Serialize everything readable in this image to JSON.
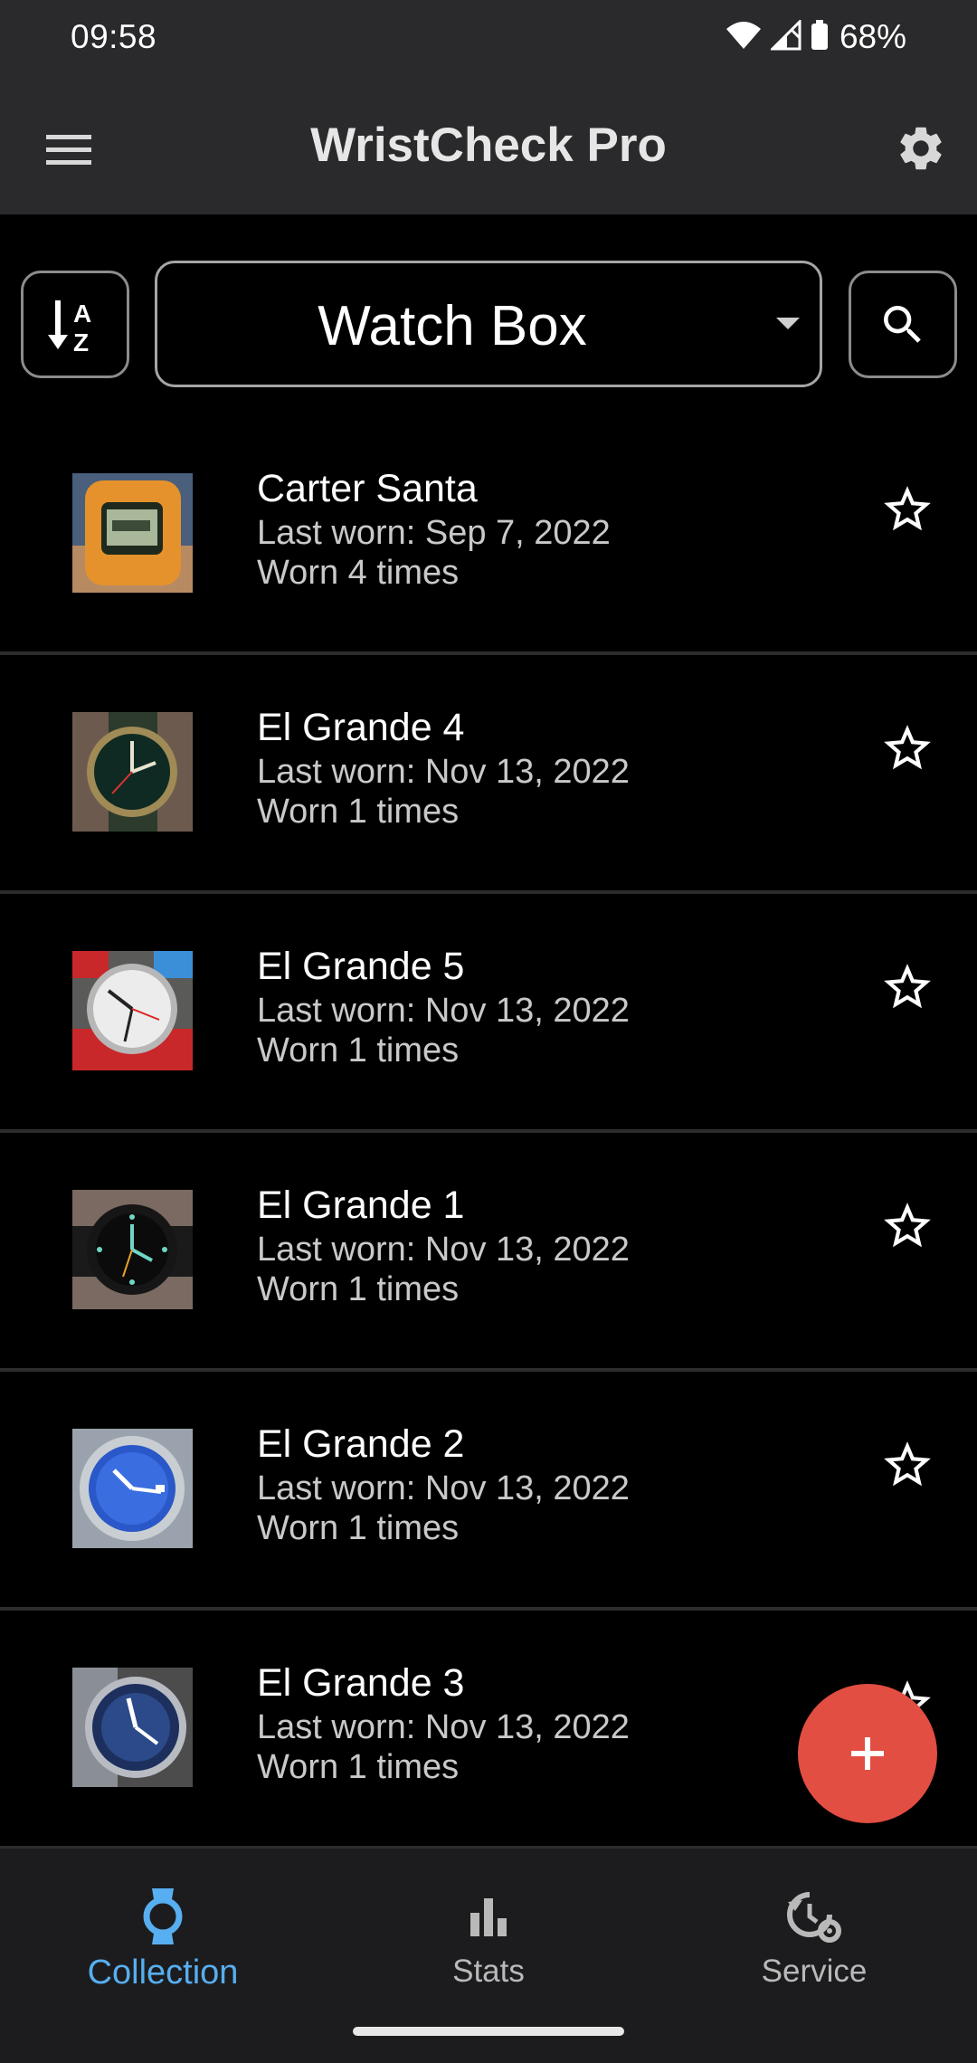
{
  "status_bar": {
    "time": "09:58",
    "battery": "68%",
    "icons": [
      "wifi-icon",
      "signal-icon",
      "battery-icon"
    ]
  },
  "app_bar": {
    "title": "WristCheck Pro",
    "menu_icon": "menu-icon",
    "settings_icon": "gear-icon"
  },
  "toolbar": {
    "sort_icon": "sort-alpha-icon",
    "collection_select": "Watch Box",
    "search_icon": "search-icon"
  },
  "watches": [
    {
      "name": "Carter Santa",
      "last_worn": "Last worn: Sep 7, 2022",
      "worn": "Worn 4 times",
      "favorite": false
    },
    {
      "name": "El Grande 4",
      "last_worn": "Last worn: Nov 13, 2022",
      "worn": "Worn 1 times",
      "favorite": false
    },
    {
      "name": "El Grande 5",
      "last_worn": "Last worn: Nov 13, 2022",
      "worn": "Worn 1 times",
      "favorite": false
    },
    {
      "name": "El Grande 1",
      "last_worn": "Last worn: Nov 13, 2022",
      "worn": "Worn 1 times",
      "favorite": false
    },
    {
      "name": "El Grande 2",
      "last_worn": "Last worn: Nov 13, 2022",
      "worn": "Worn 1 times",
      "favorite": false
    },
    {
      "name": "El Grande 3",
      "last_worn": "Last worn: Nov 13, 2022",
      "worn": "Worn 1 times",
      "favorite": false
    }
  ],
  "fab": {
    "icon": "plus-icon"
  },
  "bottom_nav": {
    "collection": "Collection",
    "stats": "Stats",
    "service": "Service",
    "active": "collection"
  },
  "colors": {
    "accent": "#57aef0",
    "fab": "#e24e42",
    "app_bar": "#2a2a2c"
  }
}
